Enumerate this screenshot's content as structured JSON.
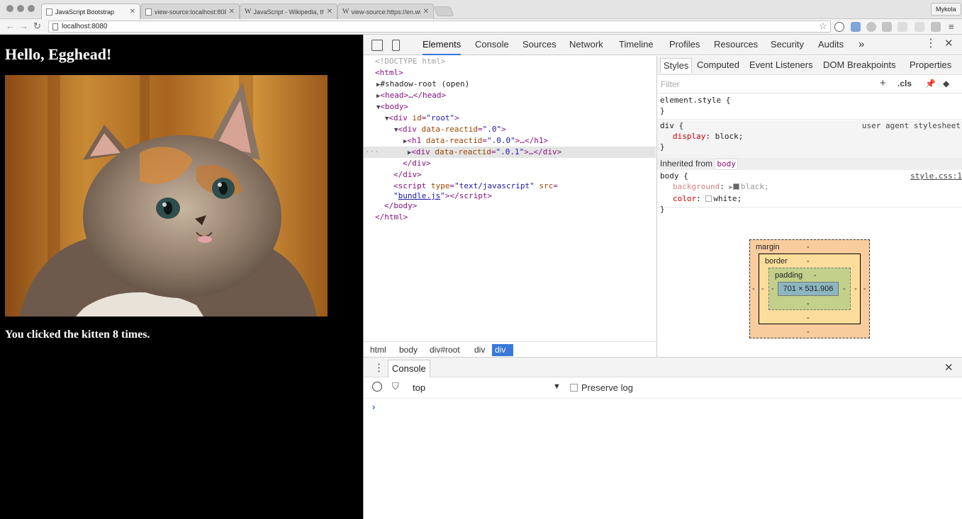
{
  "browser": {
    "tabs": [
      {
        "title": "JavaScript Bootstrap",
        "icon": "page-icon",
        "active": true
      },
      {
        "title": "view-source:localhost:808",
        "icon": "page-icon",
        "active": false
      },
      {
        "title": "JavaScript - Wikipedia, the",
        "icon": "wikipedia-icon",
        "active": false
      },
      {
        "title": "view-source:https://en.wiki",
        "icon": "wikipedia-icon",
        "active": false
      }
    ],
    "wikipedia_glyph": "W",
    "profile_name": "Mykola",
    "url": "localhost:8080"
  },
  "page": {
    "heading": "Hello, Egghead!",
    "image_alt": "kitten photo",
    "message": "You clicked the kitten 8 times."
  },
  "devtools": {
    "tabs": [
      "Elements",
      "Console",
      "Sources",
      "Network",
      "Timeline",
      "Profiles",
      "Resources",
      "Security",
      "Audits"
    ],
    "active_tab": "Elements",
    "overflow_glyph": "»",
    "dom": {
      "doctype": "<!DOCTYPE html>",
      "html_open": "<html>",
      "shadow_root": "#shadow-root (open)",
      "head": "<head>…</head>",
      "body_open": "<body>",
      "root_div_tag": "div",
      "root_div_attr": "id",
      "root_div_val": "\"root\"",
      "inner_div_attr": "data-reactid",
      "inner_div_val": "\".0\"",
      "h1_attr": "data-reactid",
      "h1_val": "\".0.0\"",
      "div01_attr": "data-reactid",
      "div01_val": "\".0.1\"",
      "div_close": "</div>",
      "script_attr_type": "type",
      "script_val_type": "\"text/javascript\"",
      "script_attr_src": "src",
      "script_src": "bundle.js",
      "body_close": "</body>",
      "html_close": "</html>",
      "selected_marker": "···"
    },
    "breadcrumbs": [
      "html",
      "body",
      "div#root",
      "div",
      "div"
    ],
    "styles": {
      "tabs": [
        "Styles",
        "Computed",
        "Event Listeners",
        "DOM Breakpoints",
        "Properties"
      ],
      "filter_placeholder": "Filter",
      "cls_label": ".cls",
      "element_style": "element.style {",
      "div_selector": "div {",
      "div_origin": "user agent stylesheet",
      "div_prop": "display",
      "div_value": "block;",
      "inherited_label": "Inherited from",
      "inherited_tag": "body",
      "body_selector": "body {",
      "body_origin": "style.css:1",
      "bg_prop": "background",
      "bg_value": "black;",
      "bg_color": "#000000",
      "color_prop": "color",
      "color_value": "white;",
      "color_color": "#ffffff",
      "close_brace": "}"
    },
    "box_model": {
      "margin_label": "margin",
      "border_label": "border",
      "padding_label": "padding",
      "dash": "-",
      "content_size": "701 × 531.906"
    },
    "console": {
      "tab_label": "Console",
      "context": "top",
      "preserve_log_label": "Preserve log",
      "prompt_glyph": "›"
    }
  }
}
